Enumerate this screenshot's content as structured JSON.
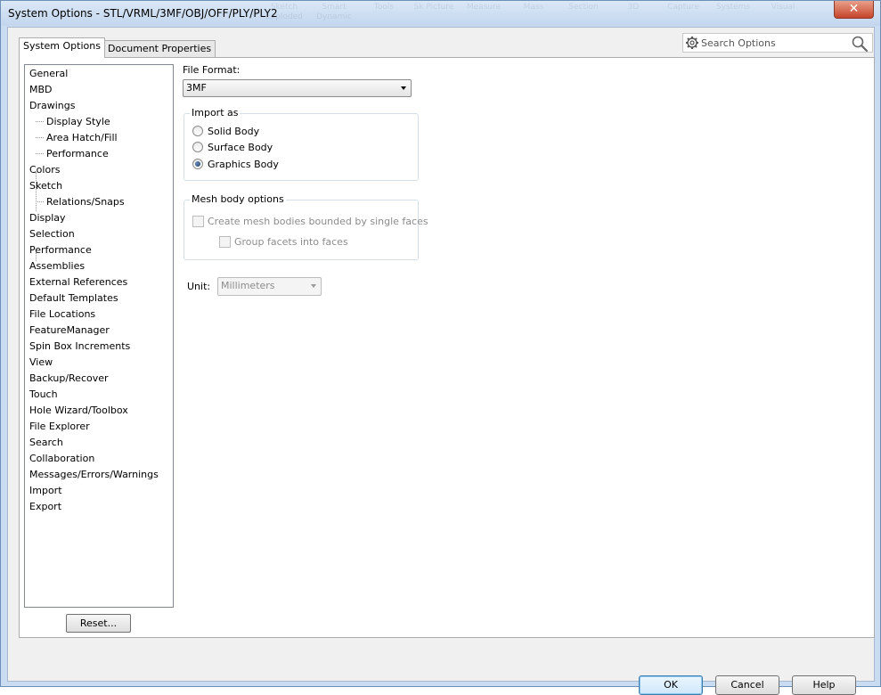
{
  "window": {
    "title": "System Options - STL/VRML/3MF/OBJ/OFF/PLY/PLY2",
    "close_glyph": "✕",
    "background_menu_text": [
      "Sketch",
      "Smart",
      "Tools",
      "Sk Picture",
      "Measure",
      "Mass",
      "Section",
      "3D",
      "Capture",
      "Systems",
      "Visual",
      "Exploded",
      "Dynamic"
    ]
  },
  "tabs": [
    {
      "label": "System Options",
      "active": true
    },
    {
      "label": "Document Properties",
      "active": false
    }
  ],
  "search": {
    "placeholder": "Search Options",
    "icon_left": "gear-icon",
    "icon_right": "magnifier-icon"
  },
  "tree": {
    "items": [
      {
        "label": "General",
        "level": 0
      },
      {
        "label": "MBD",
        "level": 0
      },
      {
        "label": "Drawings",
        "level": 0
      },
      {
        "label": "Display Style",
        "level": 1
      },
      {
        "label": "Area Hatch/Fill",
        "level": 1
      },
      {
        "label": "Performance",
        "level": 1
      },
      {
        "label": "Colors",
        "level": 0
      },
      {
        "label": "Sketch",
        "level": 0
      },
      {
        "label": "Relations/Snaps",
        "level": 1
      },
      {
        "label": "Display",
        "level": 0
      },
      {
        "label": "Selection",
        "level": 0
      },
      {
        "label": "Performance",
        "level": 0
      },
      {
        "label": "Assemblies",
        "level": 0
      },
      {
        "label": "External References",
        "level": 0
      },
      {
        "label": "Default Templates",
        "level": 0
      },
      {
        "label": "File Locations",
        "level": 0
      },
      {
        "label": "FeatureManager",
        "level": 0
      },
      {
        "label": "Spin Box Increments",
        "level": 0
      },
      {
        "label": "View",
        "level": 0
      },
      {
        "label": "Backup/Recover",
        "level": 0
      },
      {
        "label": "Touch",
        "level": 0
      },
      {
        "label": "Hole Wizard/Toolbox",
        "level": 0
      },
      {
        "label": "File Explorer",
        "level": 0
      },
      {
        "label": "Search",
        "level": 0
      },
      {
        "label": "Collaboration",
        "level": 0
      },
      {
        "label": "Messages/Errors/Warnings",
        "level": 0
      },
      {
        "label": "Import",
        "level": 0
      },
      {
        "label": "Export",
        "level": 0
      }
    ],
    "reset_label": "Reset..."
  },
  "main": {
    "file_format_label": "File Format:",
    "file_format_value": "3MF",
    "import_as": {
      "title": "Import as",
      "options": [
        {
          "label": "Solid Body",
          "selected": false
        },
        {
          "label": "Surface Body",
          "selected": false
        },
        {
          "label": "Graphics Body",
          "selected": true
        }
      ]
    },
    "mesh_options": {
      "title": "Mesh body options",
      "create_mesh_label": "Create mesh bodies bounded by single faces",
      "group_facets_label": "Group facets into faces",
      "enabled": false
    },
    "unit_label": "Unit:",
    "unit_value": "Millimeters"
  },
  "buttons": {
    "ok": "OK",
    "cancel": "Cancel",
    "help": "Help"
  },
  "colors": {
    "selection_accent": "#3c7fb1",
    "window_frame": "#c9dcf2",
    "close_button": "#c6452a"
  }
}
